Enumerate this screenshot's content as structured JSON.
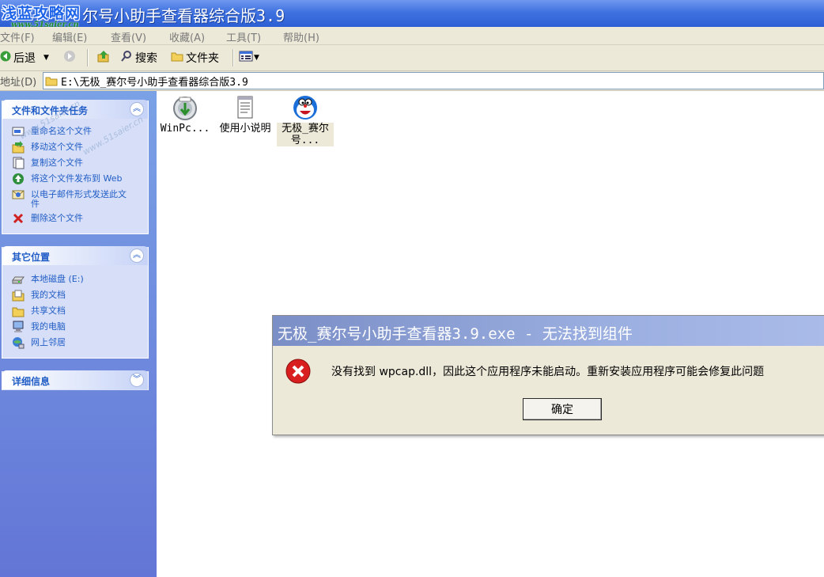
{
  "window": {
    "title": "尔号小助手查看器综合版3.9"
  },
  "watermark_logo": {
    "text": "浅蓝攻略网",
    "url": "www.51saier.cn"
  },
  "menu": [
    "文件(F)",
    "编辑(E)",
    "查看(V)",
    "收藏(A)",
    "工具(T)",
    "帮助(H)"
  ],
  "toolbar": {
    "back_label": "后退",
    "search_label": "搜索",
    "folders_label": "文件夹"
  },
  "address": {
    "label": "地址(D)",
    "path": "E:\\无极_赛尔号小助手查看器综合版3.9"
  },
  "tasks_panel": {
    "title": "文件和文件夹任务",
    "items": [
      {
        "label": "重命名这个文件",
        "icon": "rename-icon"
      },
      {
        "label": "移动这个文件",
        "icon": "move-icon"
      },
      {
        "label": "复制这个文件",
        "icon": "copy-icon"
      },
      {
        "label": "将这个文件发布到 Web",
        "icon": "publish-web-icon"
      },
      {
        "label": "以电子邮件形式发送此文件",
        "icon": "email-icon"
      },
      {
        "label": "删除这个文件",
        "icon": "delete-icon"
      }
    ]
  },
  "places_panel": {
    "title": "其它位置",
    "items": [
      {
        "label": "本地磁盘 (E:)",
        "icon": "drive-icon"
      },
      {
        "label": "我的文档",
        "icon": "my-documents-icon"
      },
      {
        "label": "共享文档",
        "icon": "shared-documents-icon"
      },
      {
        "label": "我的电脑",
        "icon": "my-computer-icon"
      },
      {
        "label": "网上邻居",
        "icon": "network-icon"
      }
    ]
  },
  "details_panel": {
    "title": "详细信息"
  },
  "files": [
    {
      "name": "WinPc...",
      "icon": "installer-icon"
    },
    {
      "name": "使用小说明",
      "icon": "text-document-icon"
    },
    {
      "name": "无极_赛尔号...",
      "icon": "doraemon-exe-icon"
    }
  ],
  "dialog": {
    "title": "无极_赛尔号小助手查看器3.9.exe - 无法找到组件",
    "message": "没有找到 wpcap.dll，因此这个应用程序未能启动。重新安装应用程序可能会修复此问题",
    "ok_label": "确定"
  }
}
